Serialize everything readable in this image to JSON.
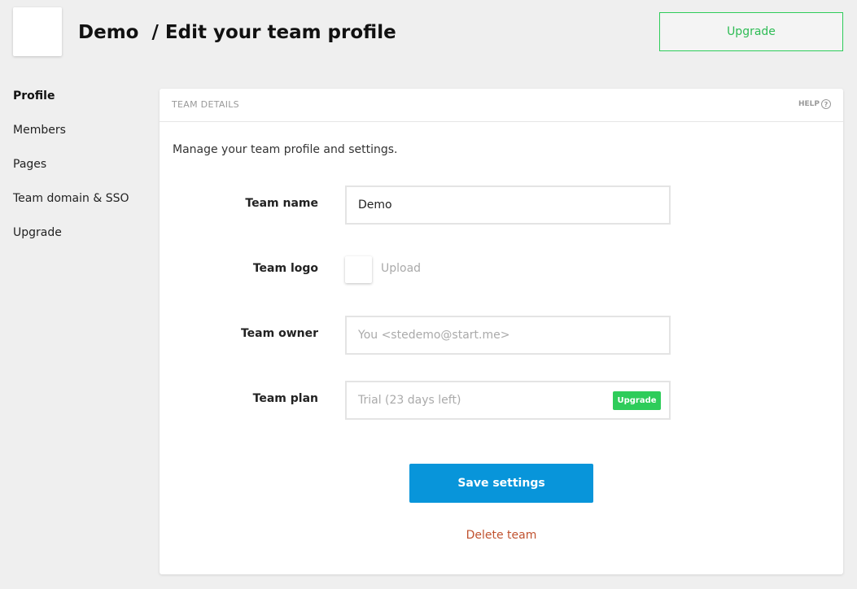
{
  "header": {
    "team_name": "Demo",
    "separator_title": "/ Edit your team profile",
    "upgrade_label": "Upgrade"
  },
  "sidebar": {
    "items": [
      {
        "label": "Profile",
        "active": true
      },
      {
        "label": "Members"
      },
      {
        "label": "Pages"
      },
      {
        "label": "Team domain & SSO"
      },
      {
        "label": "Upgrade"
      }
    ]
  },
  "card": {
    "title": "TEAM DETAILS",
    "help_label": "HELP",
    "help_icon": "?",
    "intro": "Manage your team profile and settings.",
    "fields": {
      "team_name_label": "Team name",
      "team_name_value": "Demo",
      "team_logo_label": "Team logo",
      "upload_label": "Upload",
      "team_owner_label": "Team owner",
      "team_owner_value": "You <stedemo@start.me>",
      "team_plan_label": "Team plan",
      "team_plan_value": "Trial (23 days left)",
      "plan_upgrade_label": "Upgrade"
    },
    "save_label": "Save settings",
    "delete_label": "Delete team"
  },
  "colors": {
    "accent_green": "#2ecc5a",
    "primary_blue": "#0895da",
    "danger": "#c0522f"
  }
}
